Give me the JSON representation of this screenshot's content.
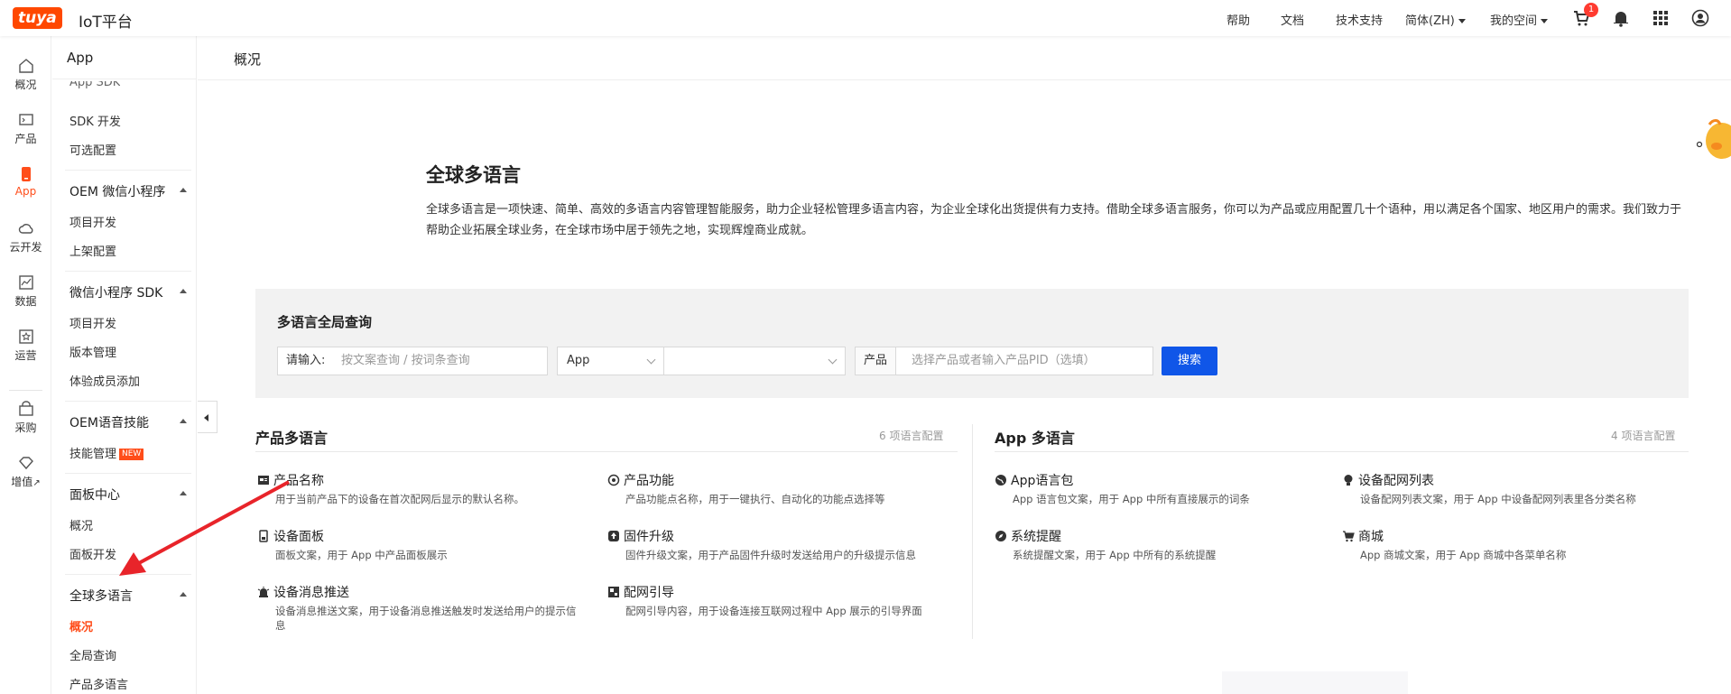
{
  "topbar": {
    "logo_text": "tuya",
    "platform_title": "IoT平台",
    "nav": [
      "帮助",
      "文档",
      "技术支持"
    ],
    "language": "简体(ZH)",
    "my_space": "我的空间",
    "cart_badge": "1"
  },
  "rail": {
    "items": [
      "概况",
      "产品",
      "App",
      "云开发",
      "数据",
      "运营",
      "采购",
      "增值"
    ],
    "external_mark": "↗"
  },
  "sidebar": {
    "header": "App",
    "partial_top": "App SDK",
    "items_top": [
      "SDK 开发",
      "可选配置"
    ],
    "groups": [
      {
        "title": "OEM 微信小程序",
        "items": [
          "项目开发",
          "上架配置"
        ]
      },
      {
        "title": "微信小程序 SDK",
        "items": [
          "项目开发",
          "版本管理",
          "体验成员添加"
        ]
      },
      {
        "title": "OEM语音技能",
        "items": [
          "技能管理"
        ]
      },
      {
        "title": "面板中心",
        "items": [
          "概况",
          "面板开发"
        ]
      },
      {
        "title": "全球多语言",
        "items": [
          "概况",
          "全局查询",
          "产品多语言"
        ]
      }
    ],
    "new_tag": "NEW"
  },
  "main": {
    "header": "概况",
    "hero_title": "全球多语言",
    "hero_desc": "全球多语言是一项快速、简单、高效的多语言内容管理智能服务，助力企业轻松管理多语言内容，为企业全球化出货提供有力支持。借助全球多语言服务，你可以为产品或应用配置几十个语种，用以满足各个国家、地区用户的需求。我们致力于帮助企业拓展全球业务，在全球市场中居于领先之地，实现辉煌商业成就。"
  },
  "query": {
    "title": "多语言全局查询",
    "input_label": "请输入:",
    "input_placeholder": "按文案查询 / 按词条查询",
    "type_select": "App",
    "second_select": "",
    "product_label": "产品",
    "product_placeholder": "选择产品或者输入产品PID（选填）",
    "search_button": "搜索"
  },
  "product_section": {
    "title": "产品多语言",
    "count": "6 项语言配置",
    "cards": [
      {
        "title": "产品名称",
        "desc": "用于当前产品下的设备在首次配网后显示的默认名称。",
        "icon": "id-card-icon"
      },
      {
        "title": "产品功能",
        "desc": "产品功能点名称，用于一键执行、自动化的功能点选择等",
        "icon": "function-icon"
      },
      {
        "title": "设备面板",
        "desc": "面板文案，用于 App 中产品面板展示",
        "icon": "panel-icon"
      },
      {
        "title": "固件升级",
        "desc": "固件升级文案，用于产品固件升级时发送给用户的升级提示信息",
        "icon": "firmware-icon"
      },
      {
        "title": "设备消息推送",
        "desc": "设备消息推送文案，用于设备消息推送触发时发送给用户的提示信息",
        "icon": "alarm-icon"
      },
      {
        "title": "配网引导",
        "desc": "配网引导内容，用于设备连接互联网过程中 App 展示的引导界面",
        "icon": "guide-icon"
      }
    ]
  },
  "app_section": {
    "title": "App 多语言",
    "count": "4 项语言配置",
    "cards": [
      {
        "title": "App语言包",
        "desc": "App 语言包文案，用于 App 中所有直接展示的词条",
        "icon": "globe-icon"
      },
      {
        "title": "设备配网列表",
        "desc": "设备配网列表文案，用于 App 中设备配网列表里各分类名称",
        "icon": "bulb-icon"
      },
      {
        "title": "系统提醒",
        "desc": "系统提醒文案，用于 App 中所有的系统提醒",
        "icon": "compass-icon"
      },
      {
        "title": "商城",
        "desc": "App 商城文案，用于 App 商城中各菜单名称",
        "icon": "cart-icon"
      }
    ]
  },
  "colors": {
    "accent": "#ff4d1a",
    "brand": "#ff4800",
    "button": "#1056e8",
    "arrow": "#e8242a"
  }
}
